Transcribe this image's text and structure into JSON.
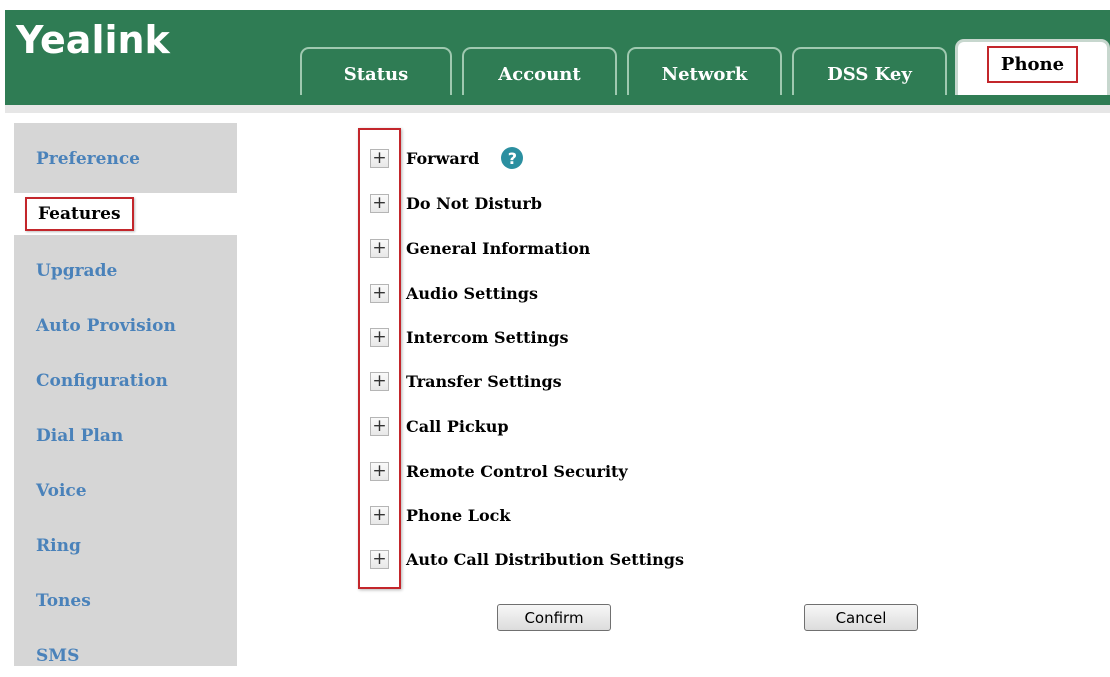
{
  "header": {
    "logo": "Yealink",
    "tabs": [
      {
        "label": "Status"
      },
      {
        "label": "Account"
      },
      {
        "label": "Network"
      },
      {
        "label": "DSS Key"
      },
      {
        "label": "Phone",
        "active": true
      }
    ]
  },
  "sidebar": {
    "items": [
      {
        "label": "Preference"
      },
      {
        "label": "Features",
        "active": true
      },
      {
        "label": "Upgrade"
      },
      {
        "label": "Auto Provision"
      },
      {
        "label": "Configuration"
      },
      {
        "label": "Dial Plan"
      },
      {
        "label": "Voice"
      },
      {
        "label": "Ring"
      },
      {
        "label": "Tones"
      },
      {
        "label": "SMS"
      }
    ]
  },
  "features": {
    "expand_symbol": "+",
    "help_symbol": "?",
    "items": [
      {
        "label": "Forward"
      },
      {
        "label": "Do Not Disturb"
      },
      {
        "label": "General Information"
      },
      {
        "label": "Audio Settings"
      },
      {
        "label": "Intercom Settings"
      },
      {
        "label": "Transfer Settings"
      },
      {
        "label": "Call Pickup"
      },
      {
        "label": "Remote Control Security"
      },
      {
        "label": "Phone Lock"
      },
      {
        "label": "Auto Call Distribution Settings"
      }
    ]
  },
  "buttons": {
    "confirm": "Confirm",
    "cancel": "Cancel"
  },
  "colors": {
    "brand_green": "#2f7c54",
    "sidebar_link": "#4a82ba",
    "highlight_red": "#c3262b",
    "help_teal": "#2b8fa0"
  }
}
